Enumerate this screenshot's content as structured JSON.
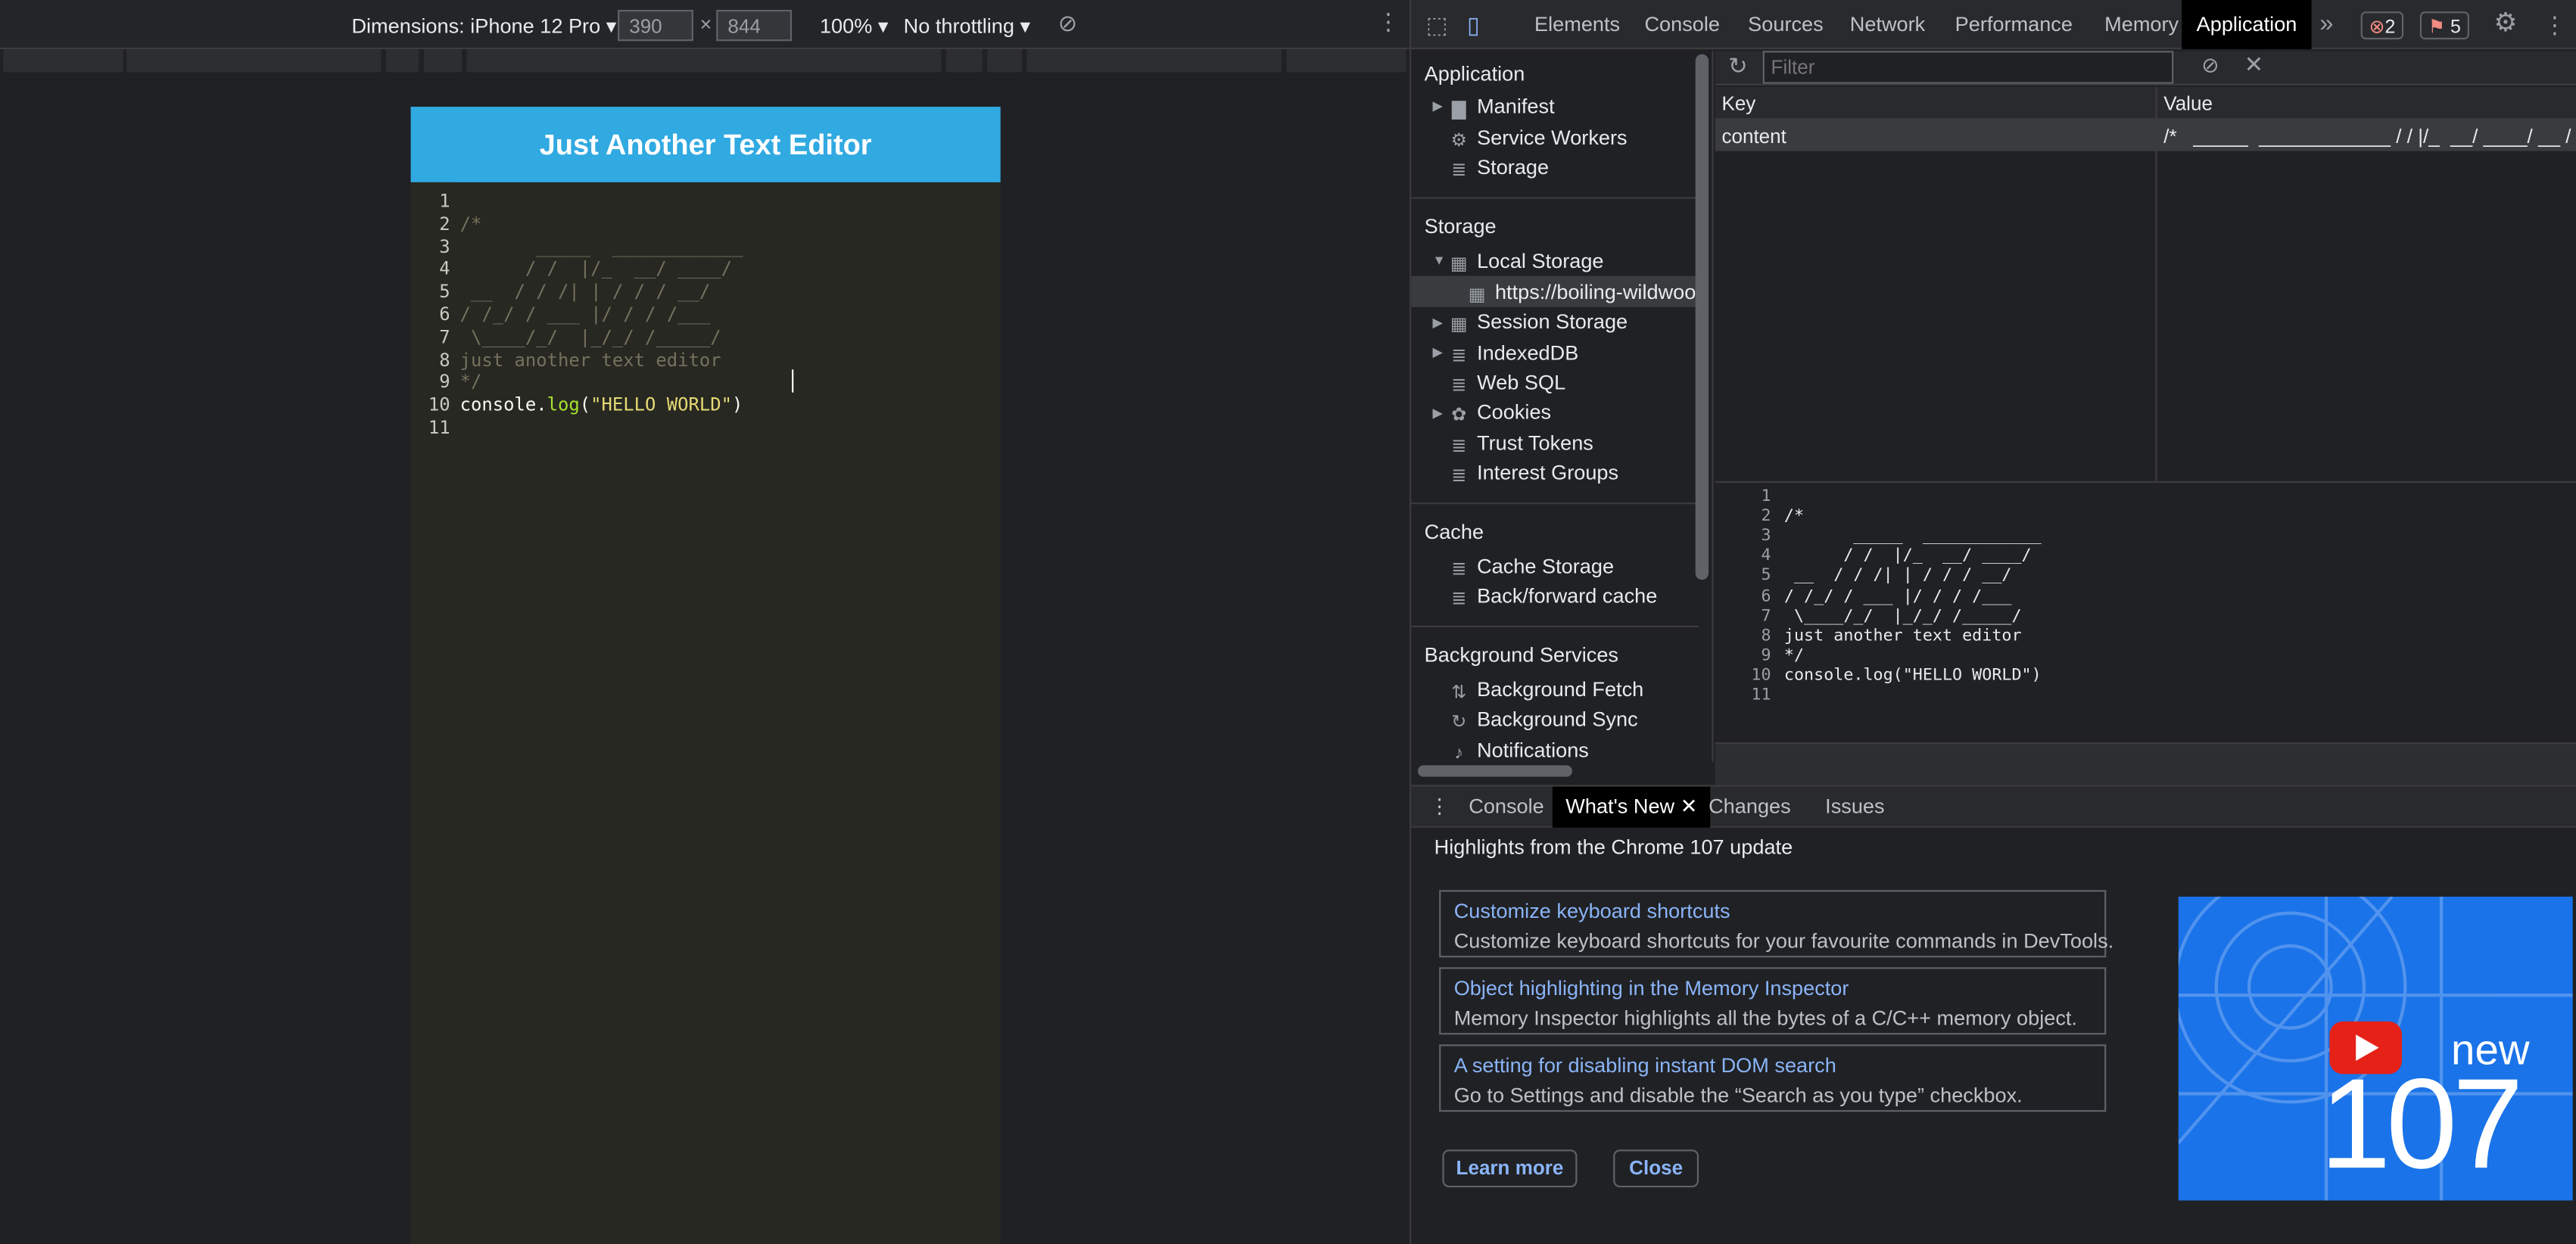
{
  "devToolbar": {
    "dimensions_label": "Dimensions: iPhone 12 Pro",
    "width_value": "390",
    "times": "×",
    "height_value": "844",
    "zoom": "100%",
    "throttling": "No throttling",
    "rotate_icon": "rotate-icon",
    "more_icon": "more-vert-icon"
  },
  "app": {
    "title": "Just Another Text Editor",
    "line_numbers": [
      "1",
      "2",
      "3",
      "4",
      "5",
      "6",
      "7",
      "8",
      "9",
      "10",
      "11"
    ],
    "code_lines": [
      {
        "cls": "cm",
        "text": ""
      },
      {
        "cls": "cm",
        "text": "/*"
      },
      {
        "cls": "cm",
        "text": "       _____  ____________"
      },
      {
        "cls": "cm",
        "text": "      / /  |/_  __/ ____/"
      },
      {
        "cls": "cm",
        "text": " __  / / /| | / / / __/"
      },
      {
        "cls": "cm",
        "text": "/ /_/ / ___ |/ / / /___"
      },
      {
        "cls": "cm",
        "text": " \\____/_/  |_/_/ /_____/"
      },
      {
        "cls": "cm",
        "text": "just another text editor"
      },
      {
        "cls": "cm",
        "text": "*/"
      }
    ],
    "code_last": {
      "obj": "console.",
      "fn": "log",
      "p1": "(",
      "str": "\"HELLO WORLD\"",
      "p2": ")"
    }
  },
  "devtools": {
    "tabs": [
      "Elements",
      "Console",
      "Sources",
      "Network",
      "Performance",
      "Memory",
      "Application"
    ],
    "active_tab": "Application",
    "more_tabs": "»",
    "errors": "2",
    "issues": "5"
  },
  "sidebar": {
    "application_header": "Application",
    "application_items": [
      "Manifest",
      "Service Workers",
      "Storage"
    ],
    "storage_header": "Storage",
    "local_storage": "Local Storage",
    "local_storage_origin": "https://boiling-wildwood",
    "storage_items": [
      "Session Storage",
      "IndexedDB",
      "Web SQL",
      "Cookies",
      "Trust Tokens",
      "Interest Groups"
    ],
    "cache_header": "Cache",
    "cache_items": [
      "Cache Storage",
      "Back/forward cache"
    ],
    "bg_header": "Background Services",
    "bg_items": [
      "Background Fetch",
      "Background Sync",
      "Notifications"
    ]
  },
  "storageTable": {
    "filter_placeholder": "Filter",
    "key_header": "Key",
    "value_header": "Value",
    "row_key": "content",
    "row_value": "/*   _____  ____________ / / |/_  __/ ____/ __ / / /| | / / / ."
  },
  "preview": {
    "line_numbers": [
      "1",
      "2",
      "3",
      "4",
      "5",
      "6",
      "7",
      "8",
      "9",
      "10",
      "11"
    ],
    "lines": [
      "",
      "/*",
      "       _____  ____________",
      "      / /  |/_  __/ ____/",
      " __  / / /| | / / / __/",
      "/ /_/ / ___ |/ / / /___",
      " \\____/_/  |_/_/ /_____/",
      "just another text editor",
      "*/",
      "console.log(\"HELLO WORLD\")",
      ""
    ]
  },
  "drawer": {
    "tabs": [
      "Console",
      "What's New",
      "Changes",
      "Issues"
    ],
    "active_tab": "What's New",
    "heading": "Highlights from the Chrome 107 update",
    "cards": [
      {
        "title": "Customize keyboard shortcuts",
        "desc": "Customize keyboard shortcuts for your favourite commands in DevTools."
      },
      {
        "title": "Object highlighting in the Memory Inspector",
        "desc": "Memory Inspector highlights all the bytes of a C/C++ memory object."
      },
      {
        "title": "A setting for disabling instant DOM search",
        "desc": "Go to Settings and disable the “Search as you type” checkbox."
      }
    ],
    "learn_more": "Learn more",
    "close": "Close",
    "promo_new": "new",
    "promo_version": "107"
  }
}
